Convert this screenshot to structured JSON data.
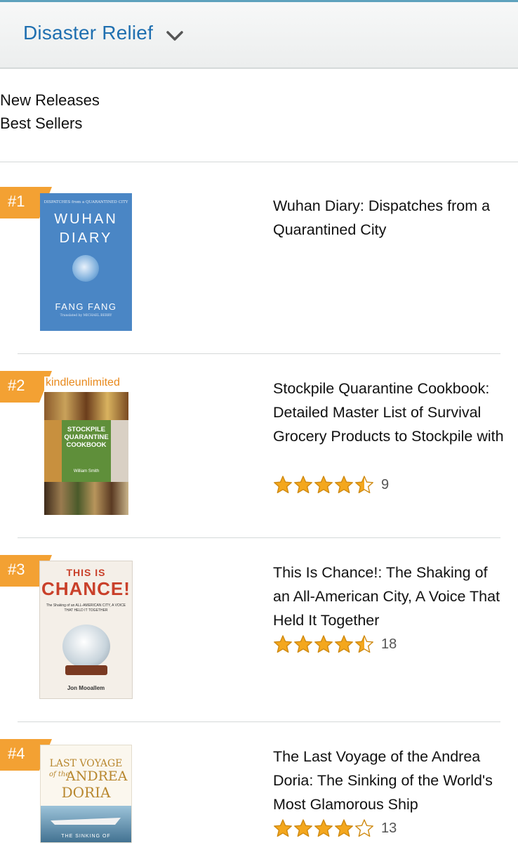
{
  "header": {
    "title": "Disaster Relief"
  },
  "links": [
    "New Releases",
    "Best Sellers"
  ],
  "colors": {
    "accent_blue": "#1f6fb0",
    "badge_orange": "#f3a133",
    "star_gold": "#f4a71d",
    "star_edge": "#cf8a12"
  },
  "items": [
    {
      "rank": "#1",
      "title": "Wuhan Diary: Dispatches from a Quarantined City",
      "cover": {
        "top_text": "DISPATCHES from a QUARANTINED CITY",
        "line1": "WUHAN",
        "line2": "DIARY",
        "author": "FANG FANG",
        "credit": "Translated by MICHAEL BERRY"
      }
    },
    {
      "rank": "#2",
      "title": "Stockpile Quarantine Cookbook: Detailed Master List of Survival Grocery Products to Stockpile with",
      "rating": 4.5,
      "reviews": "9",
      "cover": {
        "brand": "kindleunlimited",
        "line1": "STOCKPILE",
        "line2": "QUARANTINE",
        "line3": "COOKBOOK",
        "author": "William Smith"
      }
    },
    {
      "rank": "#3",
      "title": "This Is Chance!: The Shaking of an All-American City, A Voice That Held It Together",
      "rating": 4.5,
      "reviews": "18",
      "cover": {
        "line1": "THIS IS",
        "line2": "CHANCE!",
        "subtitle": "The Shaking of an ALL-AMERICAN CITY, A VOICE THAT HELD IT TOGETHER",
        "author": "Jon Mooallem"
      }
    },
    {
      "rank": "#4",
      "title": "The Last Voyage of the Andrea Doria: The Sinking of the World's Most Glamorous Ship",
      "rating": 4,
      "reviews": "13",
      "cover": {
        "line1": "LAST VOYAGE",
        "line2": "of the",
        "line3": "ANDREA",
        "line4": "DORIA",
        "bottom": "THE SINKING OF"
      }
    }
  ]
}
